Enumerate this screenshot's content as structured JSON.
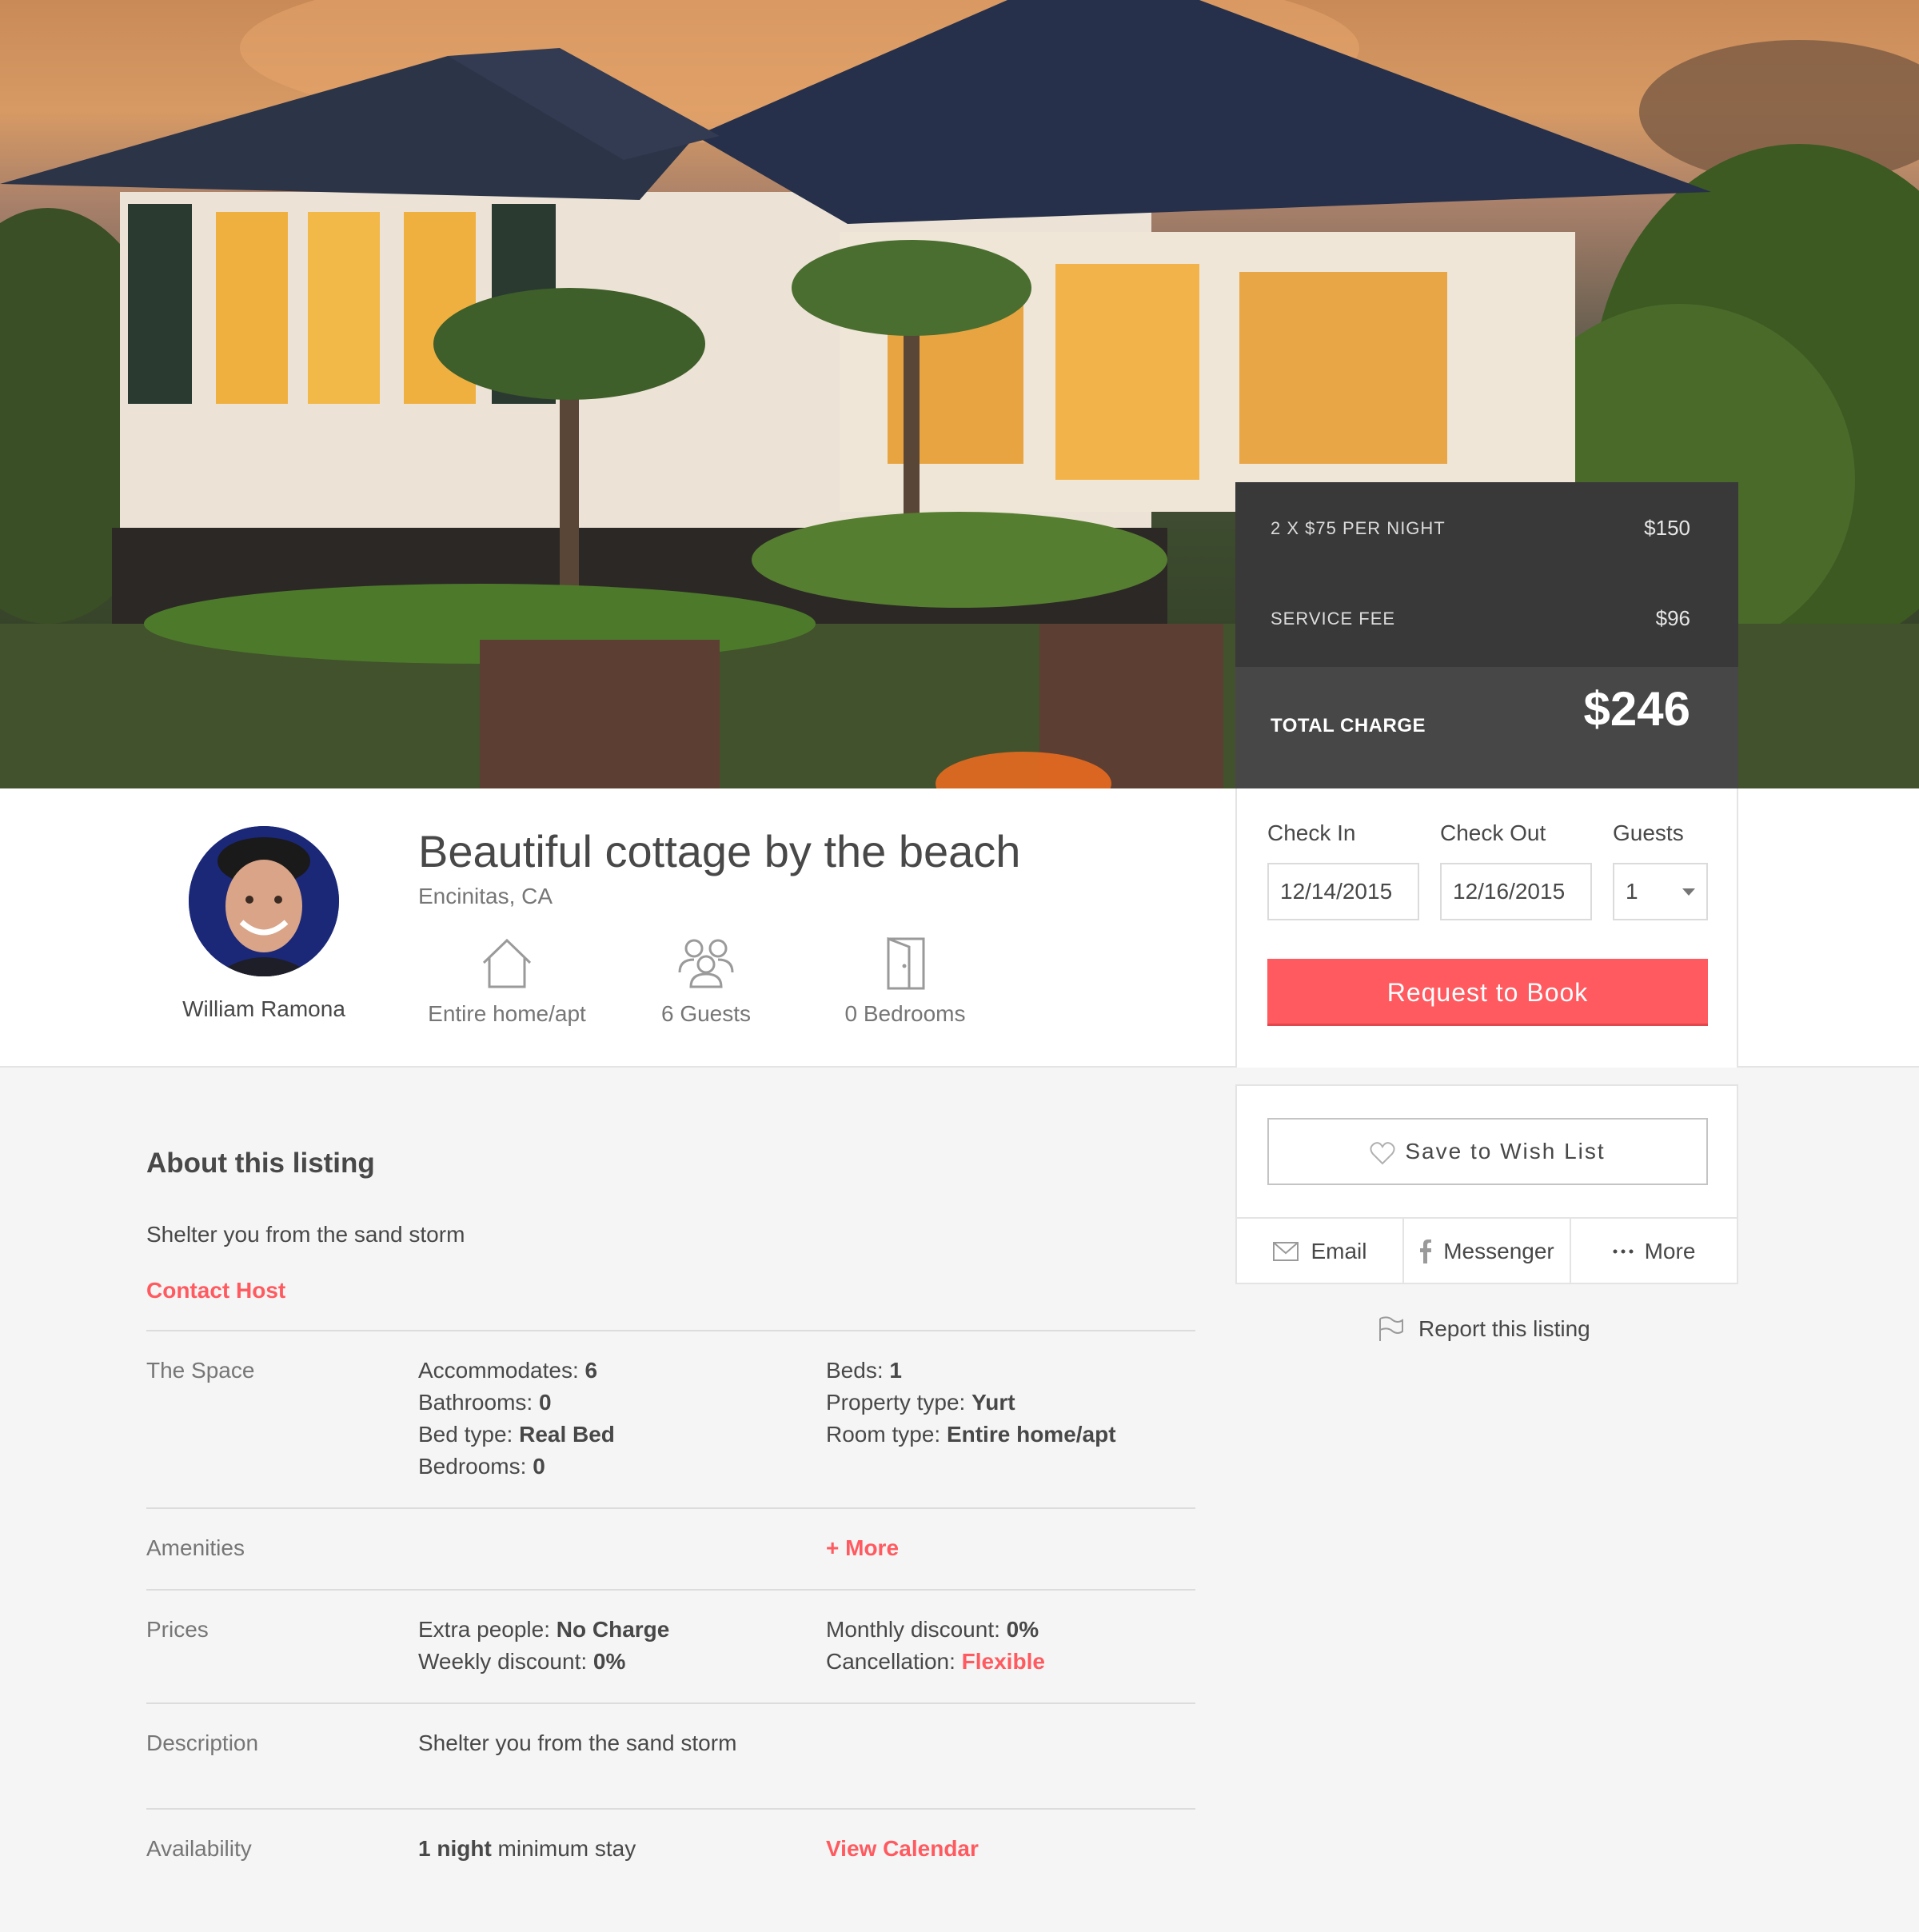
{
  "hero": {
    "image_alt": "cottage photo"
  },
  "pricing": {
    "nightly_label": "2 X $75 PER NIGHT",
    "nightly_amount": "$150",
    "service_label": "SERVICE FEE",
    "service_amount": "$96",
    "total_label": "TOTAL CHARGE",
    "total_amount": "$246"
  },
  "host": {
    "name": "William Ramona"
  },
  "listing": {
    "title": "Beautiful cottage by the beach",
    "location": "Encinitas, CA",
    "features": [
      {
        "icon": "house-icon",
        "label": "Entire home/apt"
      },
      {
        "icon": "guests-icon",
        "label": "6 Guests"
      },
      {
        "icon": "door-icon",
        "label": "0 Bedrooms"
      }
    ]
  },
  "booking": {
    "check_in_label": "Check In",
    "check_out_label": "Check Out",
    "guests_label": "Guests",
    "check_in_value": "12/14/2015",
    "check_out_value": "12/16/2015",
    "guests_value": "1",
    "request_button": "Request to Book"
  },
  "wishlist": {
    "save_label": "Save to Wish List",
    "share": [
      {
        "icon": "envelope-icon",
        "label": "Email"
      },
      {
        "icon": "facebook-icon",
        "label": "Messenger"
      },
      {
        "icon": "ellipsis-icon",
        "label": "More"
      }
    ],
    "report_label": "Report this listing"
  },
  "about": {
    "title": "About this listing",
    "summary": "Shelter you from the sand storm",
    "contact_host": "Contact Host",
    "space": {
      "label": "The Space",
      "accommodates_key": "Accommodates:",
      "accommodates_val": "6",
      "bathrooms_key": "Bathrooms:",
      "bathrooms_val": "0",
      "bed_type_key": "Bed type:",
      "bed_type_val": "Real Bed",
      "bedrooms_key": "Bedrooms:",
      "bedrooms_val": "0",
      "beds_key": "Beds:",
      "beds_val": "1",
      "property_type_key": "Property type:",
      "property_type_val": "Yurt",
      "room_type_key": "Room type:",
      "room_type_val": "Entire home/apt"
    },
    "amenities": {
      "label": "Amenities",
      "more_link": "+ More"
    },
    "prices": {
      "label": "Prices",
      "extra_key": "Extra people:",
      "extra_val": "No Charge",
      "weekly_key": "Weekly discount:",
      "weekly_val": "0%",
      "monthly_key": "Monthly discount:",
      "monthly_val": "0%",
      "cancel_key": "Cancellation:",
      "cancel_val": "Flexible"
    },
    "description": {
      "label": "Description",
      "text": "Shelter you from the sand storm"
    },
    "availability": {
      "label": "Availability",
      "nights_bold": "1 night",
      "nights_rest": "minimum stay",
      "calendar_link": "View Calendar"
    }
  },
  "colors": {
    "accent": "#ff5a5f",
    "dark_panel": "#393939",
    "text": "#484848",
    "muted": "#767676"
  }
}
